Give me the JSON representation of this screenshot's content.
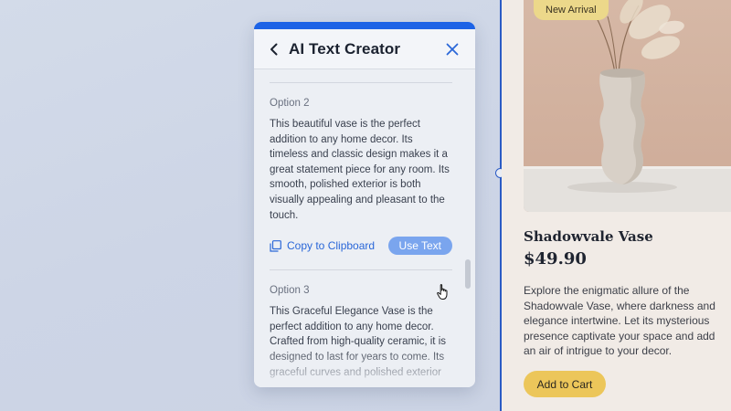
{
  "panel": {
    "title": "AI Text Creator",
    "copy_label": "Copy to Clipboard",
    "use_label": "Use Text",
    "options": [
      {
        "label": "Option 2",
        "text": "This beautiful vase is the perfect addition to any home decor. Its timeless and classic design makes it a great statement piece for any room.  Its smooth, polished exterior is both visually appealing and pleasant to the touch."
      },
      {
        "label": "Option 3",
        "text": "This Graceful Elegance Vase is the perfect addition to any home decor. Crafted from high-quality ceramic, it is designed to last for years to come. Its graceful curves and polished exterior"
      }
    ]
  },
  "product": {
    "badge": "New Arrival",
    "name": "Shadowvale Vase",
    "price": "$49.90",
    "description": "Explore the enigmatic allure of the Shadowvale Vase, where darkness and elegance intertwine. Let its mysterious presence captivate your space and add an air of intrigue to your decor.",
    "cart_label": "Add to Cart"
  },
  "colors": {
    "accent": "#1d63e6",
    "button_hover": "#7aa5ee",
    "cart": "#ecc65a",
    "badge": "#ecd88a"
  },
  "icons": [
    "back-arrow-icon",
    "close-icon",
    "copy-icon",
    "pointer-hand-icon"
  ]
}
